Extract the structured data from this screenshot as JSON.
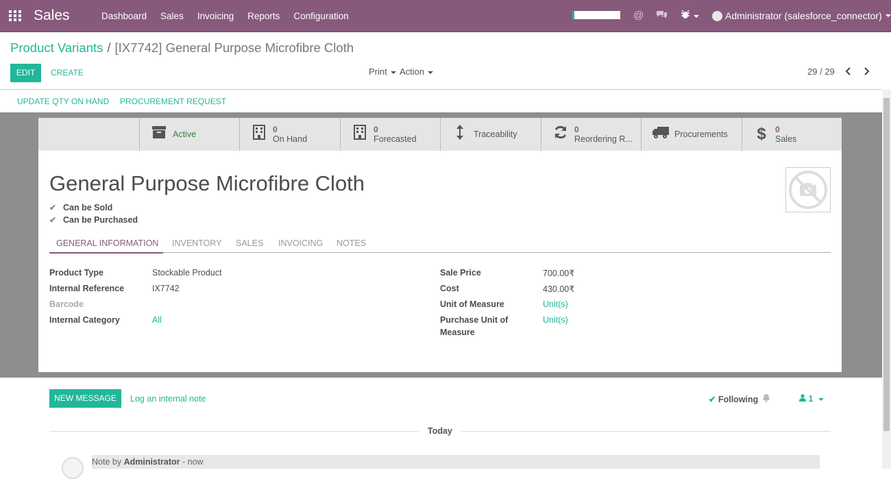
{
  "colors": {
    "brand": "#875a7b",
    "accent": "#21b799",
    "sheet_bg": "#8e8e8e"
  },
  "topbar": {
    "app_title": "Sales",
    "menu": [
      "Dashboard",
      "Sales",
      "Invoicing",
      "Reports",
      "Configuration"
    ],
    "user": "Administrator (salesforce_connector)"
  },
  "breadcrumb": {
    "parent": "Product Variants",
    "separator": "/",
    "current": "[IX7742] General Purpose Microfibre Cloth"
  },
  "actions": {
    "edit": "EDIT",
    "create": "CREATE",
    "print": "Print",
    "action": "Action"
  },
  "pager": {
    "value": "29 / 29"
  },
  "statusbar": {
    "update_qty": "UPDATE QTY ON HAND",
    "procurement": "PROCUREMENT REQUEST"
  },
  "smart_buttons": {
    "active": "Active",
    "on_hand": {
      "value": "0",
      "label": "On Hand"
    },
    "forecasted": {
      "value": "0",
      "label": "Forecasted"
    },
    "traceability": "Traceability",
    "reordering": {
      "value": "0",
      "label": "Reordering R..."
    },
    "procurements": "Procurements",
    "sales": {
      "value": "0",
      "label": "Sales"
    }
  },
  "product": {
    "name": "General Purpose Microfibre Cloth",
    "can_be_sold": "Can be Sold",
    "can_be_purchased": "Can be Purchased"
  },
  "tabs": [
    "GENERAL INFORMATION",
    "INVENTORY",
    "SALES",
    "INVOICING",
    "NOTES"
  ],
  "fields": {
    "product_type": {
      "label": "Product Type",
      "value": "Stockable Product"
    },
    "internal_reference": {
      "label": "Internal Reference",
      "value": "IX7742"
    },
    "barcode": {
      "label": "Barcode",
      "value": ""
    },
    "internal_category": {
      "label": "Internal Category",
      "value": "All"
    },
    "sale_price": {
      "label": "Sale Price",
      "value": "700.00₹"
    },
    "cost": {
      "label": "Cost",
      "value": "430.00₹"
    },
    "uom": {
      "label": "Unit of Measure",
      "value": "Unit(s)"
    },
    "purchase_uom": {
      "label": "Purchase Unit of Measure",
      "value": "Unit(s)"
    }
  },
  "chatter": {
    "new_message": "NEW MESSAGE",
    "log_note": "Log an internal note",
    "following": "Following",
    "followers_count": "1",
    "day": "Today",
    "note_prefix": "Note by",
    "note_author": "Administrator",
    "note_time": "- now"
  }
}
